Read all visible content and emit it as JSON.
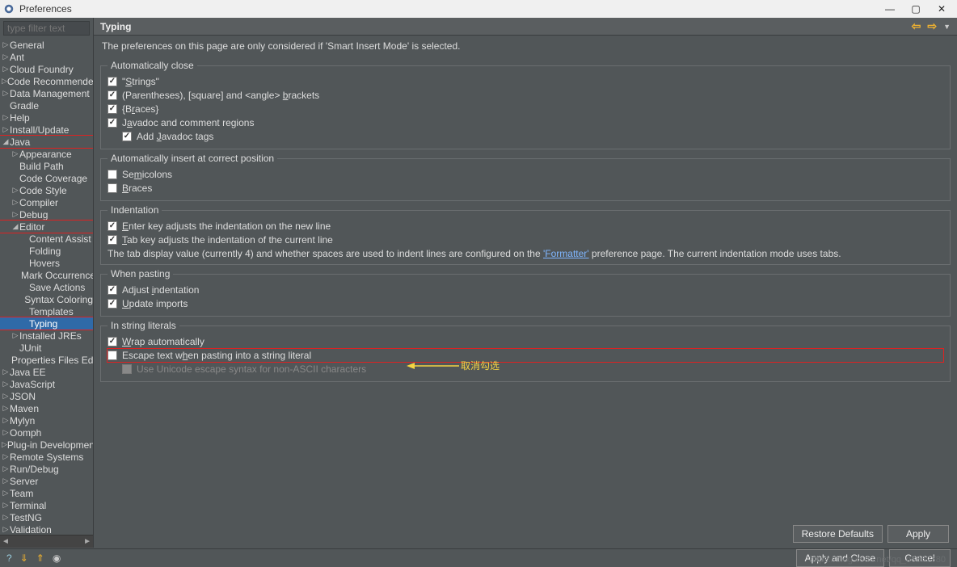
{
  "window": {
    "title": "Preferences"
  },
  "filter_placeholder": "type filter text",
  "tree": [
    {
      "label": "General",
      "depth": 0,
      "exp": false,
      "twisty": true
    },
    {
      "label": "Ant",
      "depth": 0,
      "exp": false,
      "twisty": true
    },
    {
      "label": "Cloud Foundry",
      "depth": 0,
      "exp": false,
      "twisty": true
    },
    {
      "label": "Code Recommenders",
      "depth": 0,
      "exp": false,
      "twisty": true
    },
    {
      "label": "Data Management",
      "depth": 0,
      "exp": false,
      "twisty": true
    },
    {
      "label": "Gradle",
      "depth": 0,
      "exp": false,
      "twisty": false
    },
    {
      "label": "Help",
      "depth": 0,
      "exp": false,
      "twisty": true
    },
    {
      "label": "Install/Update",
      "depth": 0,
      "exp": false,
      "twisty": true
    },
    {
      "label": "Java",
      "depth": 0,
      "exp": true,
      "twisty": true,
      "hl": true
    },
    {
      "label": "Appearance",
      "depth": 1,
      "exp": false,
      "twisty": true
    },
    {
      "label": "Build Path",
      "depth": 1,
      "exp": false,
      "twisty": false
    },
    {
      "label": "Code Coverage",
      "depth": 1,
      "exp": false,
      "twisty": false
    },
    {
      "label": "Code Style",
      "depth": 1,
      "exp": false,
      "twisty": true
    },
    {
      "label": "Compiler",
      "depth": 1,
      "exp": false,
      "twisty": true
    },
    {
      "label": "Debug",
      "depth": 1,
      "exp": false,
      "twisty": true
    },
    {
      "label": "Editor",
      "depth": 1,
      "exp": true,
      "twisty": true,
      "hl": true
    },
    {
      "label": "Content Assist",
      "depth": 2,
      "exp": false,
      "twisty": false
    },
    {
      "label": "Folding",
      "depth": 2,
      "exp": false,
      "twisty": false
    },
    {
      "label": "Hovers",
      "depth": 2,
      "exp": false,
      "twisty": false
    },
    {
      "label": "Mark Occurrences",
      "depth": 2,
      "exp": false,
      "twisty": false
    },
    {
      "label": "Save Actions",
      "depth": 2,
      "exp": false,
      "twisty": false
    },
    {
      "label": "Syntax Coloring",
      "depth": 2,
      "exp": false,
      "twisty": false
    },
    {
      "label": "Templates",
      "depth": 2,
      "exp": false,
      "twisty": false
    },
    {
      "label": "Typing",
      "depth": 2,
      "exp": false,
      "twisty": false,
      "sel": true,
      "hl": true
    },
    {
      "label": "Installed JREs",
      "depth": 1,
      "exp": false,
      "twisty": true
    },
    {
      "label": "JUnit",
      "depth": 1,
      "exp": false,
      "twisty": false
    },
    {
      "label": "Properties Files Editor",
      "depth": 1,
      "exp": false,
      "twisty": false
    },
    {
      "label": "Java EE",
      "depth": 0,
      "exp": false,
      "twisty": true
    },
    {
      "label": "JavaScript",
      "depth": 0,
      "exp": false,
      "twisty": true
    },
    {
      "label": "JSON",
      "depth": 0,
      "exp": false,
      "twisty": true
    },
    {
      "label": "Maven",
      "depth": 0,
      "exp": false,
      "twisty": true
    },
    {
      "label": "Mylyn",
      "depth": 0,
      "exp": false,
      "twisty": true
    },
    {
      "label": "Oomph",
      "depth": 0,
      "exp": false,
      "twisty": true
    },
    {
      "label": "Plug-in Development",
      "depth": 0,
      "exp": false,
      "twisty": true
    },
    {
      "label": "Remote Systems",
      "depth": 0,
      "exp": false,
      "twisty": true
    },
    {
      "label": "Run/Debug",
      "depth": 0,
      "exp": false,
      "twisty": true
    },
    {
      "label": "Server",
      "depth": 0,
      "exp": false,
      "twisty": true
    },
    {
      "label": "Team",
      "depth": 0,
      "exp": false,
      "twisty": true
    },
    {
      "label": "Terminal",
      "depth": 0,
      "exp": false,
      "twisty": true
    },
    {
      "label": "TestNG",
      "depth": 0,
      "exp": false,
      "twisty": true
    },
    {
      "label": "Validation",
      "depth": 0,
      "exp": false,
      "twisty": true
    }
  ],
  "page": {
    "heading": "Typing",
    "description": "The preferences on this page are only considered if 'Smart Insert Mode' is selected."
  },
  "groups": {
    "auto_close": {
      "legend": "Automatically close",
      "items": [
        {
          "checked": true,
          "pre": "\"",
          "ul": "S",
          "post": "trings\""
        },
        {
          "checked": true,
          "pre": "(Parentheses), [square] and <angle> ",
          "ul": "b",
          "post": "rackets"
        },
        {
          "checked": true,
          "pre": "{B",
          "ul": "r",
          "post": "aces}"
        },
        {
          "checked": true,
          "pre": "J",
          "ul": "a",
          "post": "vadoc and comment regions"
        },
        {
          "checked": true,
          "pre": "Add ",
          "ul": "J",
          "post": "avadoc tags",
          "sub": true
        }
      ]
    },
    "auto_insert": {
      "legend": "Automatically insert at correct position",
      "items": [
        {
          "checked": false,
          "pre": "Se",
          "ul": "m",
          "post": "icolons"
        },
        {
          "checked": false,
          "pre": "",
          "ul": "B",
          "post": "races"
        }
      ]
    },
    "indent": {
      "legend": "Indentation",
      "items": [
        {
          "checked": true,
          "pre": "",
          "ul": "E",
          "post": "nter key adjusts the indentation on the new line"
        },
        {
          "checked": true,
          "pre": "",
          "ul": "T",
          "post": "ab key adjusts the indentation of the current line"
        }
      ],
      "info_pre": "The tab display value (currently 4) and whether spaces are used to indent lines are configured on the ",
      "info_link": "'Formatter'",
      "info_post": " preference page. The current indentation mode uses tabs."
    },
    "pasting": {
      "legend": "When pasting",
      "items": [
        {
          "checked": true,
          "pre": "Adjust ",
          "ul": "i",
          "post": "ndentation"
        },
        {
          "checked": true,
          "pre": "",
          "ul": "U",
          "post": "pdate imports"
        }
      ]
    },
    "strings": {
      "legend": "In string literals",
      "items": [
        {
          "checked": true,
          "pre": "",
          "ul": "W",
          "post": "rap automatically"
        },
        {
          "checked": false,
          "pre": "Escape text w",
          "ul": "h",
          "post": "en pasting into a string literal",
          "hl": true
        },
        {
          "checked": false,
          "pre": "Use Unicode escape syntax for non-ASCII characters",
          "ul": "",
          "post": "",
          "sub": true,
          "disabled": true
        }
      ]
    }
  },
  "annotation": "取消勾选",
  "buttons": {
    "restore": "Restore Defaults",
    "apply": "Apply",
    "apply_close": "Apply and Close",
    "cancel": "Cancel"
  },
  "watermark": "https://blog.csdn.net/qq_d6862780"
}
